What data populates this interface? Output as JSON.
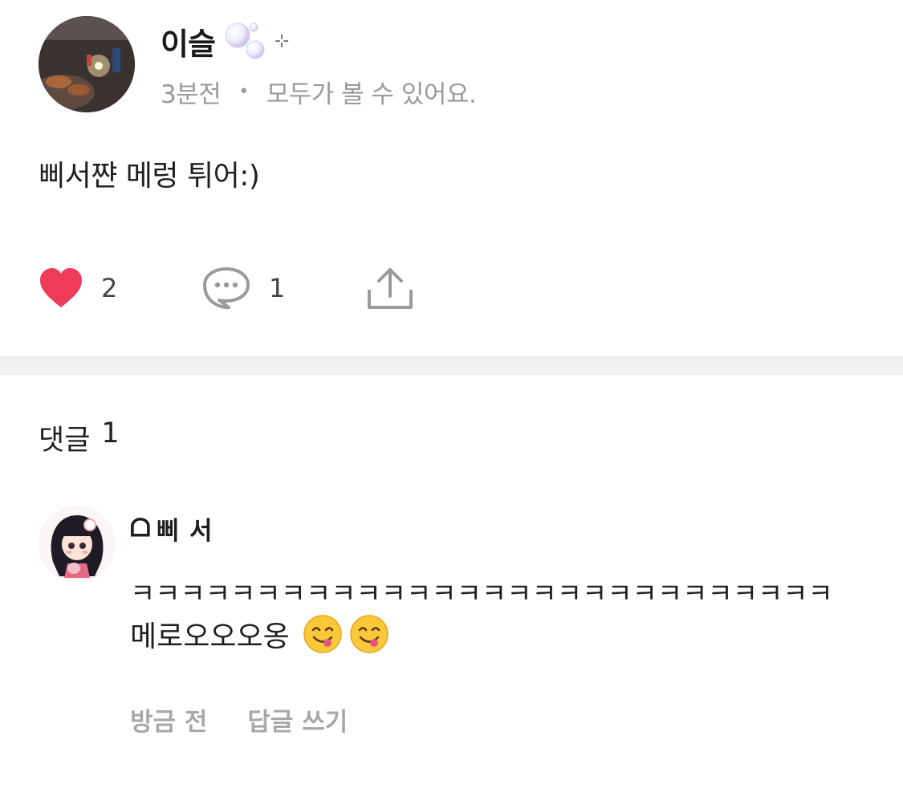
{
  "post": {
    "author_name": "이슬",
    "badge_icon": "bubbles-icon",
    "sparkle": "⊹",
    "time": "3분전",
    "separator": "•",
    "visibility": "모두가 볼 수 있어요.",
    "body": "삐서쨘 메렁 튀어:)"
  },
  "actions": {
    "like_count": "2",
    "comment_count": "1",
    "like_color": "#ee3b5a"
  },
  "comments": {
    "heading_label": "댓글",
    "heading_count": "1",
    "items": [
      {
        "author_prefix": "ᗝ",
        "author_name": "삐 서",
        "line1": "ㅋㅋㅋㅋㅋㅋㅋㅋㅋㅋㅋㅋㅋㅋㅋㅋㅋㅋㅋㅋㅋㅋㅋㅋㅋㅋㅋㅋ",
        "line2": "메로오오오옹",
        "emojis": [
          "yum-face-emoji",
          "yum-face-emoji"
        ],
        "time": "방금 전",
        "reply_label": "답글 쓰기"
      }
    ]
  }
}
